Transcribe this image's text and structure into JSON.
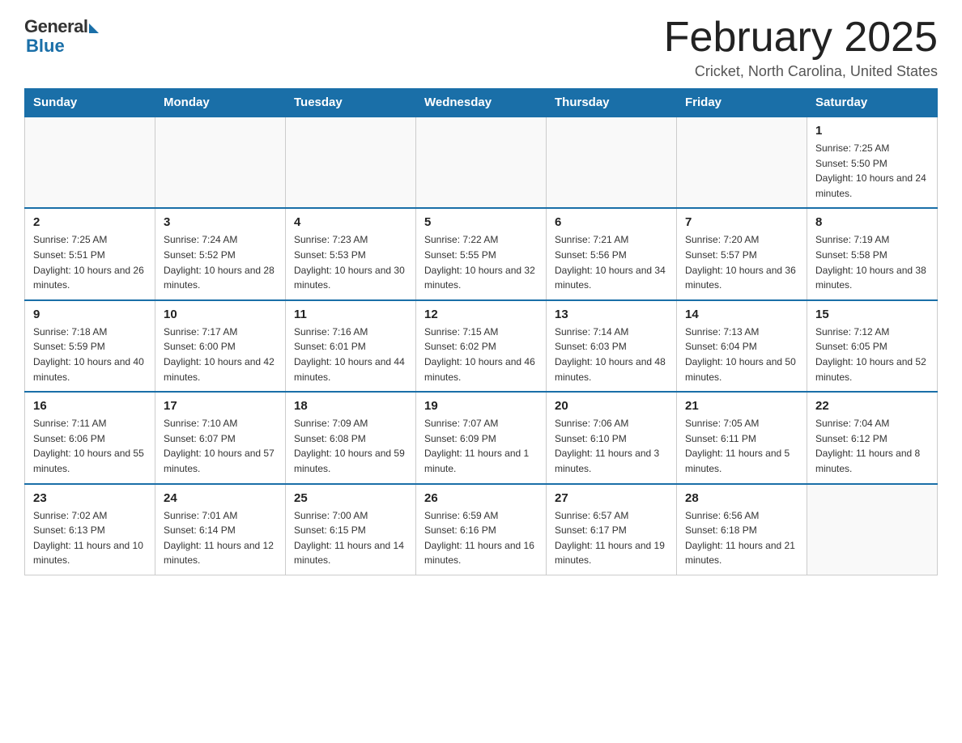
{
  "header": {
    "logo_general": "General",
    "logo_blue": "Blue",
    "title": "February 2025",
    "location": "Cricket, North Carolina, United States"
  },
  "days_of_week": [
    "Sunday",
    "Monday",
    "Tuesday",
    "Wednesday",
    "Thursday",
    "Friday",
    "Saturday"
  ],
  "weeks": [
    {
      "days": [
        {
          "num": "",
          "info": ""
        },
        {
          "num": "",
          "info": ""
        },
        {
          "num": "",
          "info": ""
        },
        {
          "num": "",
          "info": ""
        },
        {
          "num": "",
          "info": ""
        },
        {
          "num": "",
          "info": ""
        },
        {
          "num": "1",
          "info": "Sunrise: 7:25 AM\nSunset: 5:50 PM\nDaylight: 10 hours and 24 minutes."
        }
      ]
    },
    {
      "days": [
        {
          "num": "2",
          "info": "Sunrise: 7:25 AM\nSunset: 5:51 PM\nDaylight: 10 hours and 26 minutes."
        },
        {
          "num": "3",
          "info": "Sunrise: 7:24 AM\nSunset: 5:52 PM\nDaylight: 10 hours and 28 minutes."
        },
        {
          "num": "4",
          "info": "Sunrise: 7:23 AM\nSunset: 5:53 PM\nDaylight: 10 hours and 30 minutes."
        },
        {
          "num": "5",
          "info": "Sunrise: 7:22 AM\nSunset: 5:55 PM\nDaylight: 10 hours and 32 minutes."
        },
        {
          "num": "6",
          "info": "Sunrise: 7:21 AM\nSunset: 5:56 PM\nDaylight: 10 hours and 34 minutes."
        },
        {
          "num": "7",
          "info": "Sunrise: 7:20 AM\nSunset: 5:57 PM\nDaylight: 10 hours and 36 minutes."
        },
        {
          "num": "8",
          "info": "Sunrise: 7:19 AM\nSunset: 5:58 PM\nDaylight: 10 hours and 38 minutes."
        }
      ]
    },
    {
      "days": [
        {
          "num": "9",
          "info": "Sunrise: 7:18 AM\nSunset: 5:59 PM\nDaylight: 10 hours and 40 minutes."
        },
        {
          "num": "10",
          "info": "Sunrise: 7:17 AM\nSunset: 6:00 PM\nDaylight: 10 hours and 42 minutes."
        },
        {
          "num": "11",
          "info": "Sunrise: 7:16 AM\nSunset: 6:01 PM\nDaylight: 10 hours and 44 minutes."
        },
        {
          "num": "12",
          "info": "Sunrise: 7:15 AM\nSunset: 6:02 PM\nDaylight: 10 hours and 46 minutes."
        },
        {
          "num": "13",
          "info": "Sunrise: 7:14 AM\nSunset: 6:03 PM\nDaylight: 10 hours and 48 minutes."
        },
        {
          "num": "14",
          "info": "Sunrise: 7:13 AM\nSunset: 6:04 PM\nDaylight: 10 hours and 50 minutes."
        },
        {
          "num": "15",
          "info": "Sunrise: 7:12 AM\nSunset: 6:05 PM\nDaylight: 10 hours and 52 minutes."
        }
      ]
    },
    {
      "days": [
        {
          "num": "16",
          "info": "Sunrise: 7:11 AM\nSunset: 6:06 PM\nDaylight: 10 hours and 55 minutes."
        },
        {
          "num": "17",
          "info": "Sunrise: 7:10 AM\nSunset: 6:07 PM\nDaylight: 10 hours and 57 minutes."
        },
        {
          "num": "18",
          "info": "Sunrise: 7:09 AM\nSunset: 6:08 PM\nDaylight: 10 hours and 59 minutes."
        },
        {
          "num": "19",
          "info": "Sunrise: 7:07 AM\nSunset: 6:09 PM\nDaylight: 11 hours and 1 minute."
        },
        {
          "num": "20",
          "info": "Sunrise: 7:06 AM\nSunset: 6:10 PM\nDaylight: 11 hours and 3 minutes."
        },
        {
          "num": "21",
          "info": "Sunrise: 7:05 AM\nSunset: 6:11 PM\nDaylight: 11 hours and 5 minutes."
        },
        {
          "num": "22",
          "info": "Sunrise: 7:04 AM\nSunset: 6:12 PM\nDaylight: 11 hours and 8 minutes."
        }
      ]
    },
    {
      "days": [
        {
          "num": "23",
          "info": "Sunrise: 7:02 AM\nSunset: 6:13 PM\nDaylight: 11 hours and 10 minutes."
        },
        {
          "num": "24",
          "info": "Sunrise: 7:01 AM\nSunset: 6:14 PM\nDaylight: 11 hours and 12 minutes."
        },
        {
          "num": "25",
          "info": "Sunrise: 7:00 AM\nSunset: 6:15 PM\nDaylight: 11 hours and 14 minutes."
        },
        {
          "num": "26",
          "info": "Sunrise: 6:59 AM\nSunset: 6:16 PM\nDaylight: 11 hours and 16 minutes."
        },
        {
          "num": "27",
          "info": "Sunrise: 6:57 AM\nSunset: 6:17 PM\nDaylight: 11 hours and 19 minutes."
        },
        {
          "num": "28",
          "info": "Sunrise: 6:56 AM\nSunset: 6:18 PM\nDaylight: 11 hours and 21 minutes."
        },
        {
          "num": "",
          "info": ""
        }
      ]
    }
  ]
}
